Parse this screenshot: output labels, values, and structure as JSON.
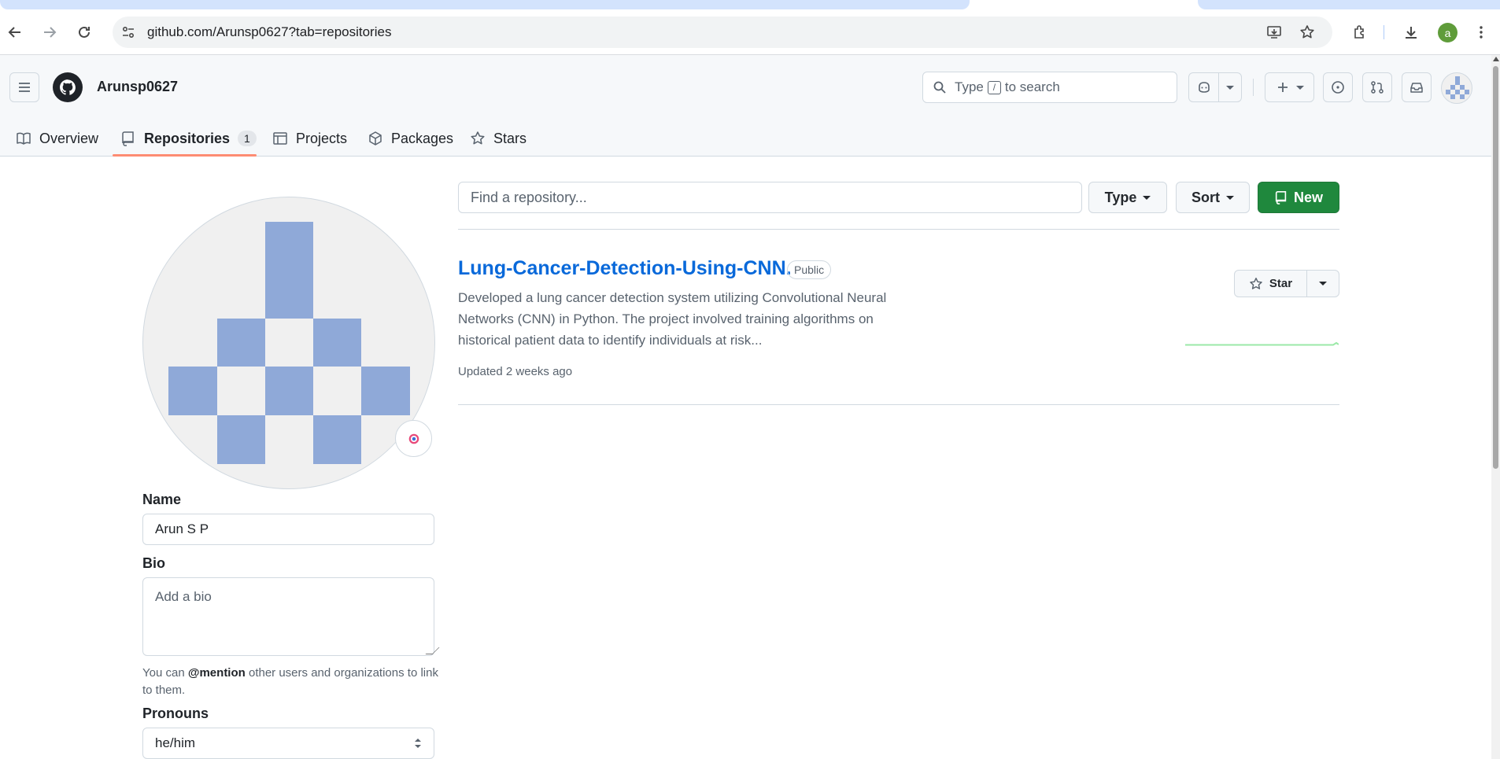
{
  "browser": {
    "url": "github.com/Arunsp0627?tab=repositories",
    "profile_initial": "a",
    "profile_color": "#5f9c3a"
  },
  "header": {
    "username": "Arunsp0627",
    "search_prefix": "Type",
    "search_key": "/",
    "search_suffix": "to search"
  },
  "tabs": [
    {
      "label": "Overview",
      "icon": "book-icon"
    },
    {
      "label": "Repositories",
      "icon": "repo-icon",
      "count": "1"
    },
    {
      "label": "Projects",
      "icon": "table-icon"
    },
    {
      "label": "Packages",
      "icon": "package-icon"
    },
    {
      "label": "Stars",
      "icon": "star-icon"
    }
  ],
  "profile": {
    "name_label": "Name",
    "name_value": "Arun S P",
    "bio_label": "Bio",
    "bio_placeholder": "Add a bio",
    "hint_prefix": "You can",
    "hint_mention": "@mention",
    "hint_suffix": "other users and organizations to link to them.",
    "pronouns_label": "Pronouns",
    "pronouns_value": "he/him"
  },
  "filters": {
    "find_placeholder": "Find a repository...",
    "type_label": "Type",
    "sort_label": "Sort",
    "new_label": "New"
  },
  "repos": [
    {
      "name": "Lung-Cancer-Detection-Using-CNN.",
      "visibility": "Public",
      "description": "Developed a lung cancer detection system utilizing Convolutional Neural Networks (CNN) in Python. The project involved training algorithms on historical patient data to identify individuals at risk...",
      "updated": "Updated 2 weeks ago",
      "star_label": "Star"
    }
  ],
  "colors": {
    "accent": "#0969da",
    "new_button": "#1f883d",
    "identicon": "#8fa9d8",
    "active_tab_underline": "#fd8c73"
  }
}
